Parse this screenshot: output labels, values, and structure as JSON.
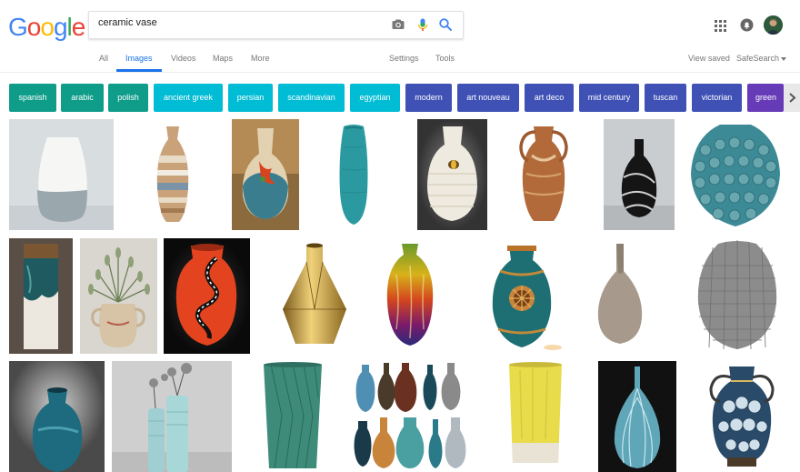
{
  "logo": {
    "letters": [
      "G",
      "o",
      "o",
      "g",
      "l",
      "e"
    ],
    "colors": [
      "#4285f4",
      "#ea4335",
      "#fbbc05",
      "#4285f4",
      "#34a853",
      "#ea4335"
    ]
  },
  "search": {
    "query": "ceramic vase"
  },
  "nav": {
    "tabs": [
      "All",
      "Images",
      "Videos",
      "Maps",
      "More"
    ],
    "settings": "Settings",
    "tools": "Tools",
    "view_saved": "View saved",
    "safesearch": "SafeSearch"
  },
  "chips": [
    {
      "label": "spanish",
      "color": "#0f9d8a"
    },
    {
      "label": "arabic",
      "color": "#0f9d8a"
    },
    {
      "label": "polish",
      "color": "#0f9d8a"
    },
    {
      "label": "ancient greek",
      "color": "#00bcd4"
    },
    {
      "label": "persian",
      "color": "#00bcd4"
    },
    {
      "label": "scandinavian",
      "color": "#00bcd4"
    },
    {
      "label": "egyptian",
      "color": "#00bcd4"
    },
    {
      "label": "modern",
      "color": "#3f51b5"
    },
    {
      "label": "art nouveau",
      "color": "#3f51b5"
    },
    {
      "label": "art deco",
      "color": "#3f51b5"
    },
    {
      "label": "mid century",
      "color": "#3f51b5"
    },
    {
      "label": "tuscan",
      "color": "#3f51b5"
    },
    {
      "label": "victorian",
      "color": "#3f51b5"
    },
    {
      "label": "green",
      "color": "#673ab7"
    }
  ],
  "icons": {
    "camera": "camera-icon",
    "mic": "mic-icon",
    "search": "search-icon",
    "apps": "apps-grid-icon",
    "notifications": "bell-icon",
    "next": "chevron-right-icon"
  }
}
